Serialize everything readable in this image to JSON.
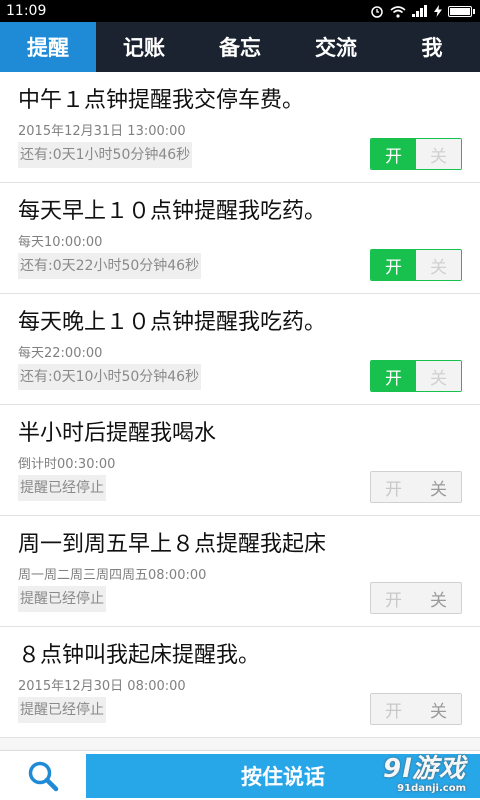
{
  "status_bar": {
    "time": "11:09",
    "icons": [
      "alarm-icon",
      "wifi-icon",
      "signal-icon",
      "charging-icon",
      "battery-icon"
    ]
  },
  "tabs": [
    {
      "label": "提醒",
      "active": true
    },
    {
      "label": "记账",
      "active": false
    },
    {
      "label": "备忘",
      "active": false
    },
    {
      "label": "交流",
      "active": false
    },
    {
      "label": "我",
      "active": false
    }
  ],
  "items": [
    {
      "title": "中午１点钟提醒我交停车费。",
      "time": "2015年12月31日 13:00:00",
      "status": "还有:0天1小时50分钟46秒",
      "on": true
    },
    {
      "title": "每天早上１０点钟提醒我吃药。",
      "time": "每天10:00:00",
      "status": "还有:0天22小时50分钟46秒",
      "on": true
    },
    {
      "title": "每天晚上１０点钟提醒我吃药。",
      "time": "每天22:00:00",
      "status": "还有:0天10小时50分钟46秒",
      "on": true
    },
    {
      "title": "半小时后提醒我喝水",
      "time": "倒计时00:30:00",
      "status": "提醒已经停止",
      "on": false
    },
    {
      "title": "周一到周五早上８点提醒我起床",
      "time": "周一周二周三周四周五08:00:00",
      "status": "提醒已经停止",
      "on": false
    },
    {
      "title": "８点钟叫我起床提醒我。",
      "time": "2015年12月30日 08:00:00",
      "status": "提醒已经停止",
      "on": false
    }
  ],
  "toggle": {
    "on_label": "开",
    "off_label": "关"
  },
  "bottom": {
    "voice_label": "按住说话",
    "search_icon": "search-icon"
  },
  "watermark": {
    "main": "9l游戏",
    "sub": "91danji.com"
  },
  "colors": {
    "tab_active": "#1f8bd6",
    "tab_bg": "#1b2230",
    "toggle_on": "#18c04e",
    "voice_button": "#27a6e8"
  }
}
